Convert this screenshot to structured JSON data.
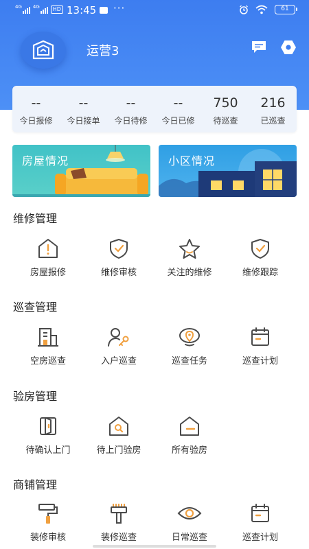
{
  "status_bar": {
    "sim1": "4G",
    "sim2": "4G",
    "hd": "HD",
    "time": "13:45",
    "dots": "···",
    "battery": "61"
  },
  "header": {
    "username": "运营3",
    "icons": [
      "logo-icon",
      "message-icon",
      "settings-icon"
    ]
  },
  "stats": [
    {
      "value": "--",
      "label": "今日报修"
    },
    {
      "value": "--",
      "label": "今日接单"
    },
    {
      "value": "--",
      "label": "今日待修"
    },
    {
      "value": "--",
      "label": "今日已修"
    },
    {
      "value": "750",
      "label": "待巡查"
    },
    {
      "value": "216",
      "label": "已巡查"
    }
  ],
  "banners": [
    {
      "title": "房屋情况"
    },
    {
      "title": "小区情况"
    }
  ],
  "sections": [
    {
      "title": "维修管理",
      "items": [
        {
          "label": "房屋报修",
          "icon": "house-alert-icon"
        },
        {
          "label": "维修审核",
          "icon": "shield-check-icon"
        },
        {
          "label": "关注的维修",
          "icon": "star-icon"
        },
        {
          "label": "维修跟踪",
          "icon": "shield-check-icon"
        }
      ]
    },
    {
      "title": "巡查管理",
      "items": [
        {
          "label": "空房巡查",
          "icon": "building-icon"
        },
        {
          "label": "入户巡查",
          "icon": "person-key-icon"
        },
        {
          "label": "巡查任务",
          "icon": "location-icon"
        },
        {
          "label": "巡查计划",
          "icon": "calendar-icon"
        }
      ]
    },
    {
      "title": "验房管理",
      "items": [
        {
          "label": "待确认上门",
          "icon": "door-icon"
        },
        {
          "label": "待上门验房",
          "icon": "house-search-icon"
        },
        {
          "label": "所有验房",
          "icon": "house-outline-icon"
        }
      ]
    },
    {
      "title": "商铺管理",
      "items": [
        {
          "label": "装修审核",
          "icon": "paint-roller-icon"
        },
        {
          "label": "装修巡查",
          "icon": "brush-icon"
        },
        {
          "label": "日常巡查",
          "icon": "eye-icon"
        },
        {
          "label": "巡查计划",
          "icon": "calendar-icon"
        }
      ]
    }
  ],
  "colors": {
    "primary_blue": "#3d7df0",
    "icon_dark": "#4a4a4a",
    "icon_accent": "#f0a040"
  }
}
